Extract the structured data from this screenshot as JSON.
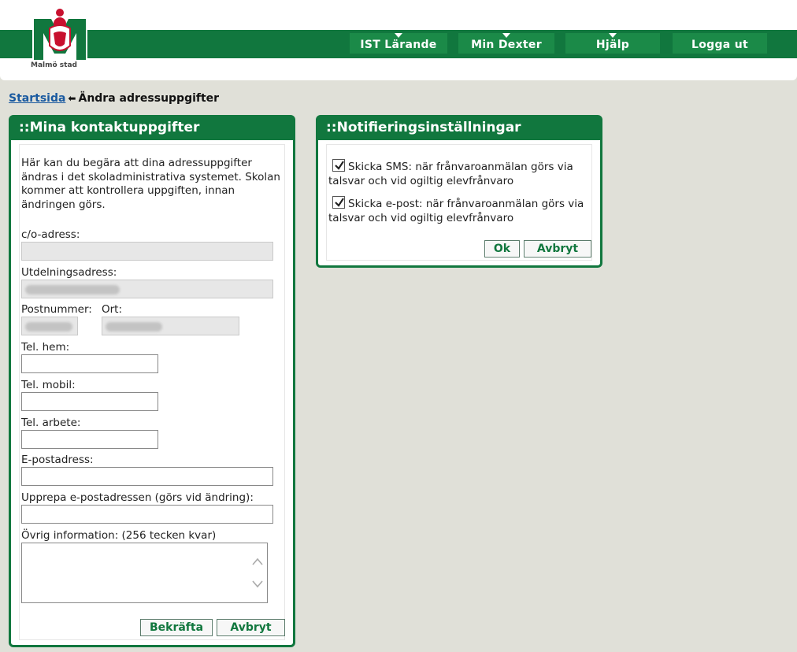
{
  "header": {
    "logo_text": "Malmö stad",
    "nav": [
      {
        "label": "IST Lärande"
      },
      {
        "label": "Min Dexter"
      },
      {
        "label": "Hjälp"
      },
      {
        "label": "Logga ut"
      }
    ]
  },
  "breadcrumb": {
    "home": "Startsida",
    "current": "Ändra adressuppgifter"
  },
  "contact": {
    "title": "::Mina kontaktuppgifter",
    "intro": "Här kan du begära att dina adressuppgifter ändras i det skoladministrativa systemet. Skolan kommer att kontrollera uppgiften, innan ändringen görs.",
    "co_label": "c/o-adress:",
    "address_label": "Utdelningsadress:",
    "zip_label": "Postnummer:",
    "city_label": "Ort:",
    "phone_home_label": "Tel. hem:",
    "phone_mobile_label": "Tel. mobil:",
    "phone_work_label": "Tel. arbete:",
    "email_label": "E-postadress:",
    "email_repeat_label": "Upprepa e-postadressen (görs vid ändring):",
    "other_info_label": "Övrig information: (256 tecken kvar)",
    "confirm_label": "Bekräfta",
    "cancel_label": "Avbryt"
  },
  "notifications": {
    "title": "::Notifieringsinställningar",
    "sms_label": "Skicka SMS: när frånvaroanmälan görs via talsvar och vid ogiltig elevfrånvaro",
    "sms_checked": true,
    "email_label": "Skicka e-post: när frånvaroanmälan görs via talsvar och vid ogiltig elevfrånvaro",
    "email_checked": true,
    "ok_label": "Ok",
    "cancel_label": "Avbryt"
  },
  "colors": {
    "brand_green": "#11773e",
    "background": "#e0e0d8"
  }
}
